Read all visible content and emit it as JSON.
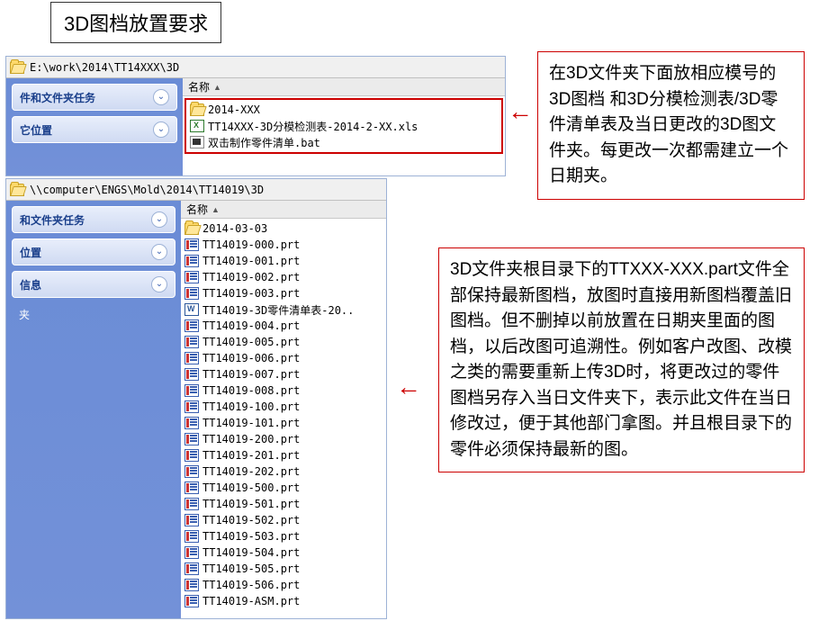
{
  "title": "3D图档放置要求",
  "annotation1": "在3D文件夹下面放相应模号的3D图档 和3D分模检测表/3D零件清单表及当日更改的3D图文件夹。每更改一次都需建立一个日期夹。",
  "annotation2": "3D文件夹根目录下的TTXXX-XXX.part文件全部保持最新图档，放图时直接用新图档覆盖旧图档。但不删掉以前放置在日期夹里面的图档，以后改图可追溯性。例如客户改图、改模之类的需要重新上传3D时，将更改过的零件图档另存入当日文件夹下，表示此文件在当日修改过，便于其他部门拿图。并且根目录下的零件必须保持最新的图。",
  "win1": {
    "address": "E:\\work\\2014\\TT14XXX\\3D",
    "header_name": "名称",
    "sidebar": {
      "task1": "件和文件夹任务",
      "task2": "它位置"
    },
    "files": [
      {
        "icon": "folder-open",
        "name": "2014-XXX"
      },
      {
        "icon": "xls",
        "name": "TT14XXX-3D分模检测表-2014-2-XX.xls"
      },
      {
        "icon": "bat",
        "name": "双击制作零件清单.bat"
      }
    ]
  },
  "win2": {
    "address": "\\\\computer\\ENGS\\Mold\\2014\\TT14019\\3D",
    "header_name": "名称",
    "sidebar": {
      "task1": "和文件夹任务",
      "task2": "位置",
      "task3": "信息",
      "plain": "夹"
    },
    "files": [
      {
        "icon": "folder-open",
        "name": "2014-03-03"
      },
      {
        "icon": "prt",
        "name": "TT14019-000.prt"
      },
      {
        "icon": "prt",
        "name": "TT14019-001.prt"
      },
      {
        "icon": "prt",
        "name": "TT14019-002.prt"
      },
      {
        "icon": "prt",
        "name": "TT14019-003.prt"
      },
      {
        "icon": "doc",
        "name": "TT14019-3D零件清单表-20.."
      },
      {
        "icon": "prt",
        "name": "TT14019-004.prt"
      },
      {
        "icon": "prt",
        "name": "TT14019-005.prt"
      },
      {
        "icon": "prt",
        "name": "TT14019-006.prt"
      },
      {
        "icon": "prt",
        "name": "TT14019-007.prt"
      },
      {
        "icon": "prt",
        "name": "TT14019-008.prt"
      },
      {
        "icon": "prt",
        "name": "TT14019-100.prt"
      },
      {
        "icon": "prt",
        "name": "TT14019-101.prt"
      },
      {
        "icon": "prt",
        "name": "TT14019-200.prt"
      },
      {
        "icon": "prt",
        "name": "TT14019-201.prt"
      },
      {
        "icon": "prt",
        "name": "TT14019-202.prt"
      },
      {
        "icon": "prt",
        "name": "TT14019-500.prt"
      },
      {
        "icon": "prt",
        "name": "TT14019-501.prt"
      },
      {
        "icon": "prt",
        "name": "TT14019-502.prt"
      },
      {
        "icon": "prt",
        "name": "TT14019-503.prt"
      },
      {
        "icon": "prt",
        "name": "TT14019-504.prt"
      },
      {
        "icon": "prt",
        "name": "TT14019-505.prt"
      },
      {
        "icon": "prt",
        "name": "TT14019-506.prt"
      },
      {
        "icon": "prt",
        "name": "TT14019-ASM.prt"
      }
    ]
  }
}
